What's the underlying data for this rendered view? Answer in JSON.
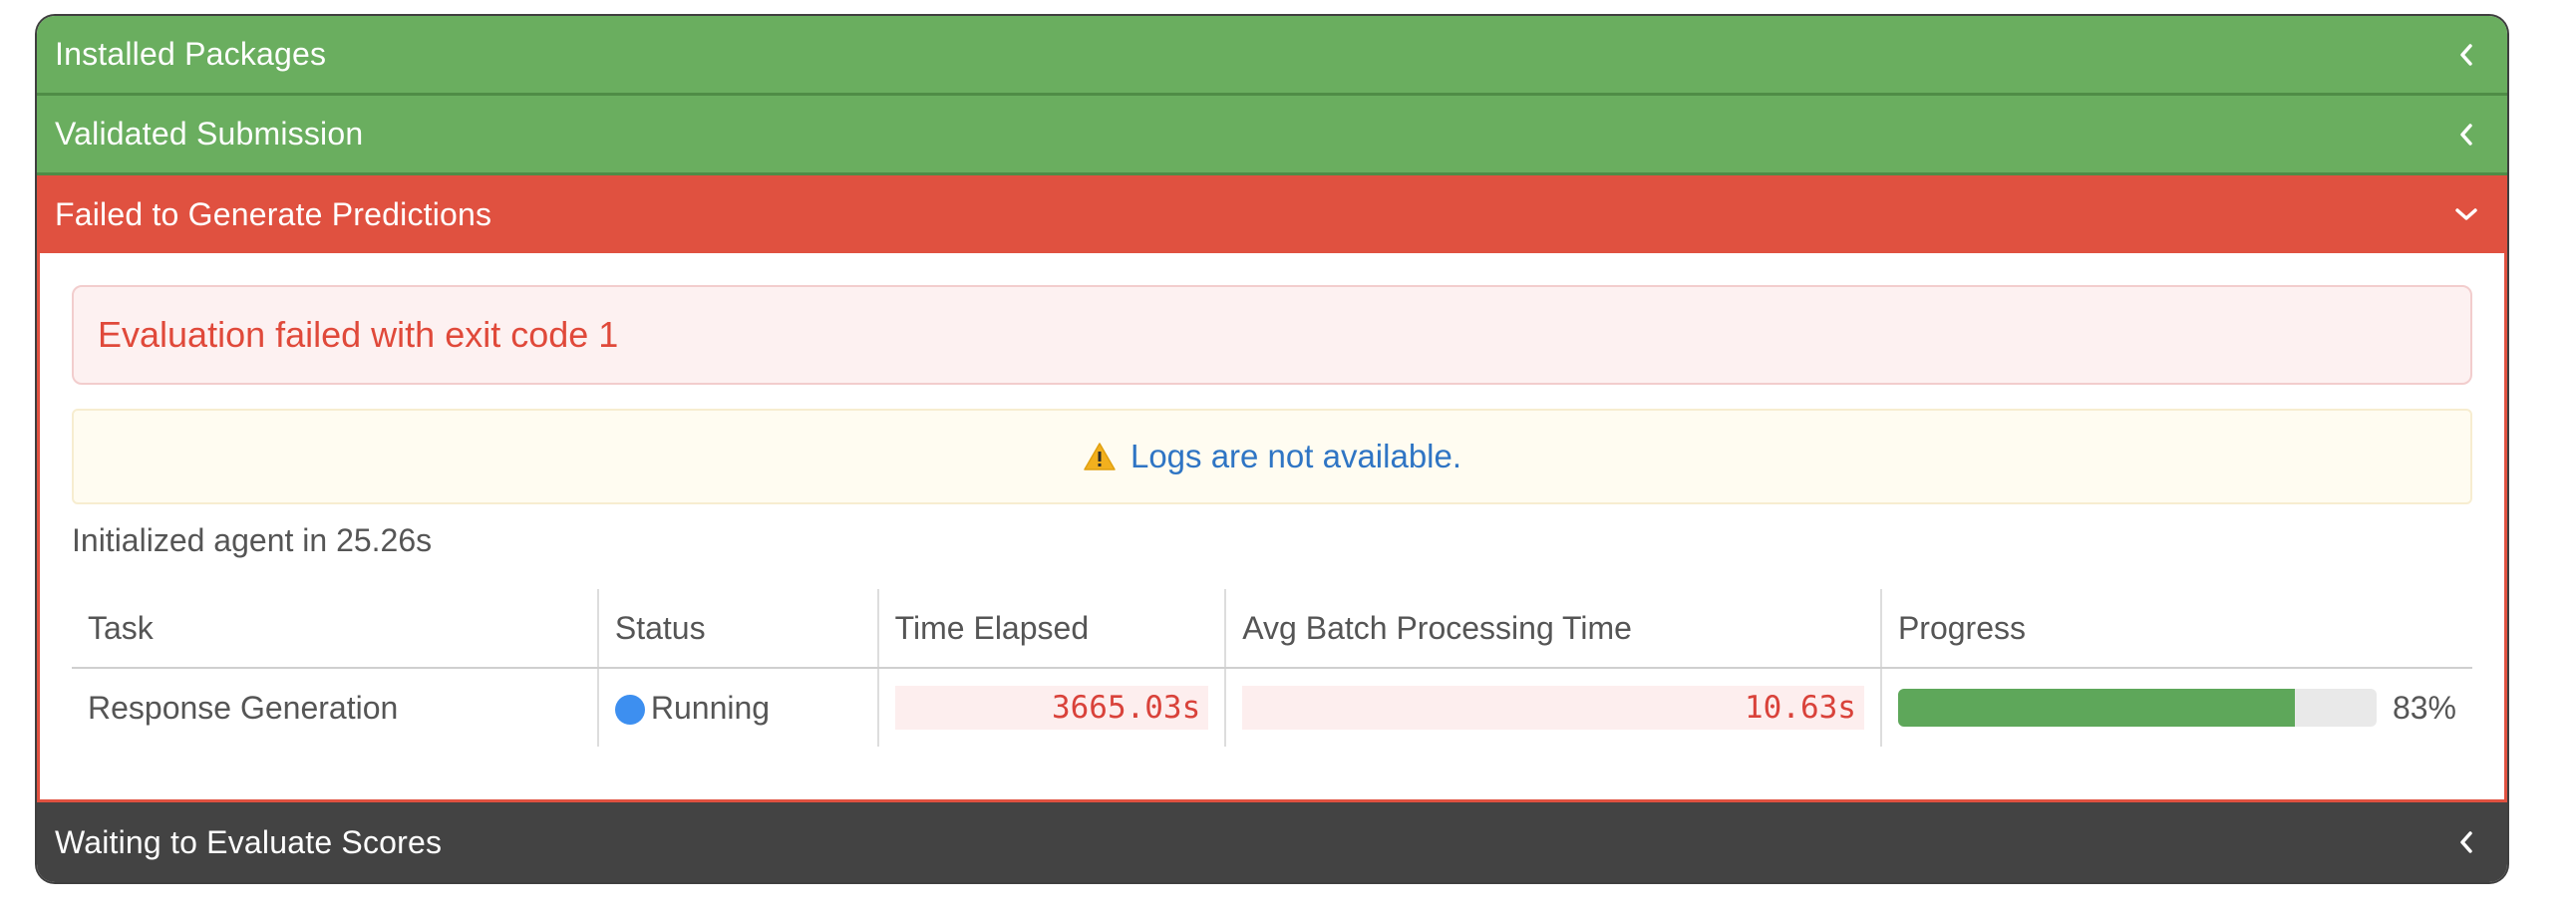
{
  "sections": {
    "installed": {
      "title": "Installed Packages"
    },
    "validated": {
      "title": "Validated Submission"
    },
    "failed": {
      "title": "Failed to Generate Predictions"
    },
    "waiting": {
      "title": "Waiting to Evaluate Scores"
    }
  },
  "failed_panel": {
    "error_message": "Evaluation failed with exit code 1",
    "logs_message": "Logs are not available.",
    "init_text": "Initialized agent in 25.26s"
  },
  "table": {
    "headers": [
      "Task",
      "Status",
      "Time Elapsed",
      "Avg Batch Processing Time",
      "Progress"
    ],
    "rows": [
      {
        "task": "Response Generation",
        "status": "Running",
        "time_elapsed": "3665.03s",
        "avg_batch": "10.63s",
        "progress_text": "83%",
        "progress_fraction": 0.83
      }
    ]
  },
  "colors": {
    "success": "#6aae5f",
    "danger": "#e05140",
    "pending": "#434343",
    "running_dot": "#3d8ff0",
    "progress_fill": "#5ea75a"
  },
  "icons": {
    "collapsed": "chevron-left-icon",
    "expanded": "chevron-down-icon",
    "warning": "warning-icon",
    "status": "status-dot-icon"
  }
}
